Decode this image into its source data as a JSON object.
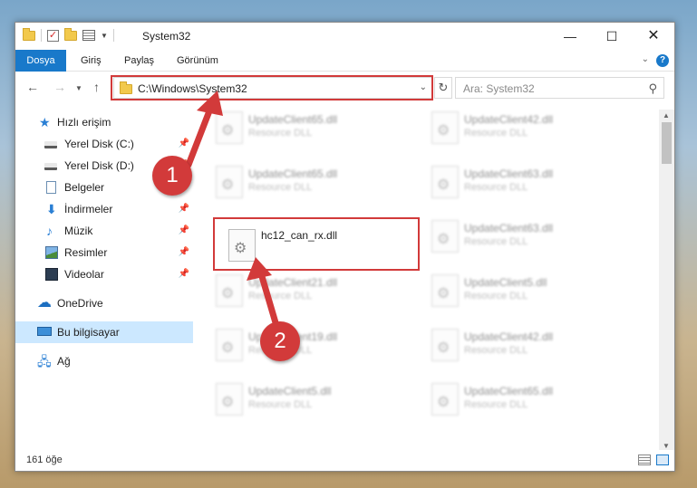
{
  "window": {
    "title": "System32",
    "controls": {
      "minimize": "—",
      "maximize": "☐",
      "close": "✕"
    }
  },
  "ribbon": {
    "tabs": [
      "Dosya",
      "Giriş",
      "Paylaş",
      "Görünüm"
    ],
    "help": "?"
  },
  "navigation": {
    "address": "C:\\Windows\\System32",
    "search_placeholder": "Ara: System32"
  },
  "sidebar": {
    "items": [
      {
        "label": "Hızlı erişim",
        "icon": "star-icon"
      },
      {
        "label": "Yerel Disk (C:)",
        "icon": "disk-icon",
        "pinned": true
      },
      {
        "label": "Yerel Disk (D:)",
        "icon": "disk-icon",
        "pinned": true
      },
      {
        "label": "Belgeler",
        "icon": "document-icon",
        "pinned": true
      },
      {
        "label": "İndirmeler",
        "icon": "download-icon",
        "pinned": true
      },
      {
        "label": "Müzik",
        "icon": "music-icon",
        "pinned": true
      },
      {
        "label": "Resimler",
        "icon": "pictures-icon",
        "pinned": true
      },
      {
        "label": "Videolar",
        "icon": "videos-icon",
        "pinned": true
      },
      {
        "label": "OneDrive",
        "icon": "cloud-icon"
      },
      {
        "label": "Bu bilgisayar",
        "icon": "computer-icon",
        "selected": true
      },
      {
        "label": "Ağ",
        "icon": "network-icon"
      }
    ]
  },
  "files": [
    {
      "name": "UpdateClient65.dll",
      "type": "Resource DLL"
    },
    {
      "name": "UpdateClient42.dll",
      "type": "Resource DLL"
    },
    {
      "name": "UpdateClient65.dll",
      "type": "Resource DLL"
    },
    {
      "name": "UpdateClient63.dll",
      "type": "Resource DLL"
    },
    {
      "name": "hc12_can_rx.dll",
      "type": ""
    },
    {
      "name": "UpdateClient63.dll",
      "type": "Resource DLL"
    },
    {
      "name": "UpdateClient21.dll",
      "type": "Resource DLL"
    },
    {
      "name": "UpdateClient5.dll",
      "type": "Resource DLL"
    },
    {
      "name": "UpdateClient19.dll",
      "type": "Resource DLL"
    },
    {
      "name": "UpdateClient42.dll",
      "type": "Resource DLL"
    },
    {
      "name": "UpdateClient5.dll",
      "type": "Resource DLL"
    },
    {
      "name": "UpdateClient65.dll",
      "type": "Resource DLL"
    }
  ],
  "status": {
    "count": "161 öğe"
  },
  "callouts": [
    "1",
    "2"
  ],
  "colors": {
    "accent": "#1979ca",
    "callout": "#d23a3a",
    "selected": "#cce8ff"
  }
}
